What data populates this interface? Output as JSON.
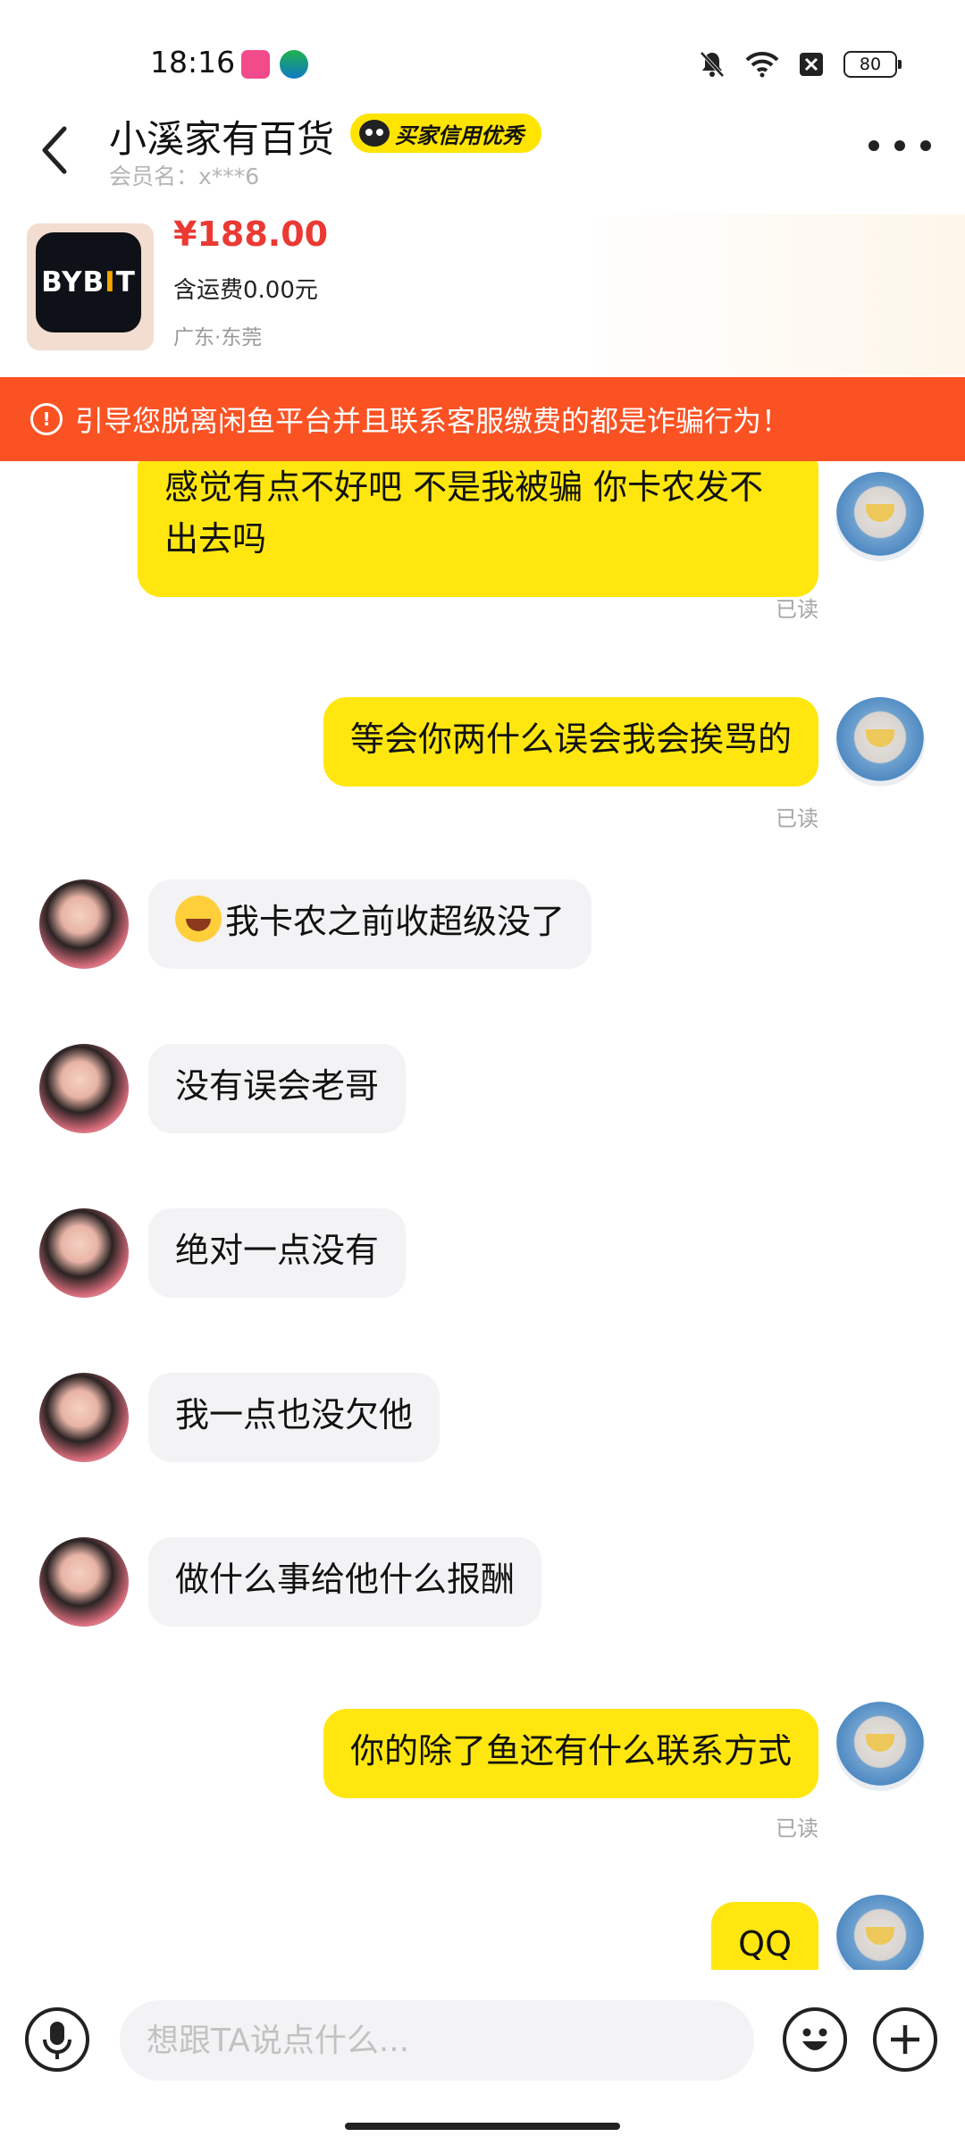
{
  "status_bar": {
    "time": "18:16",
    "battery": "80"
  },
  "header": {
    "shop_name": "小溪家有百货",
    "credit_badge": "买家信用优秀",
    "member_label": "会员名：",
    "member_name": "x***6"
  },
  "product": {
    "logo_text_a": "BYB",
    "logo_text_b": "I",
    "logo_text_c": "T",
    "price": "¥188.00",
    "shipping": "含运费0.00元",
    "location": "广东·东莞"
  },
  "warning": {
    "icon": "!",
    "text": "引导您脱离闲鱼平台并且联系客服缴费的都是诈骗行为！"
  },
  "messages": [
    {
      "from": "me",
      "text": "感觉有点不好吧 不是我被骗 你卡农发不出去吗",
      "status": "已读"
    },
    {
      "from": "me",
      "text": "等会你两什么误会我会挨骂的",
      "status": "已读"
    },
    {
      "from": "them",
      "text": "我卡农之前收超级没了",
      "emoji": "crying-laughing"
    },
    {
      "from": "them",
      "text": "没有误会老哥"
    },
    {
      "from": "them",
      "text": "绝对一点没有"
    },
    {
      "from": "them",
      "text": "我一点也没欠他"
    },
    {
      "from": "them",
      "text": "做什么事给他什么报酬"
    },
    {
      "from": "me",
      "text": "你的除了鱼还有什么联系方式",
      "status": "已读"
    },
    {
      "from": "me",
      "text": "QQ"
    }
  ],
  "input": {
    "placeholder": "想跟TA说点什么..."
  },
  "icons": {
    "back": "back-arrow-icon",
    "more": "more-dots-icon",
    "mic": "microphone-icon",
    "emoji": "emoji-icon",
    "plus": "plus-icon"
  }
}
